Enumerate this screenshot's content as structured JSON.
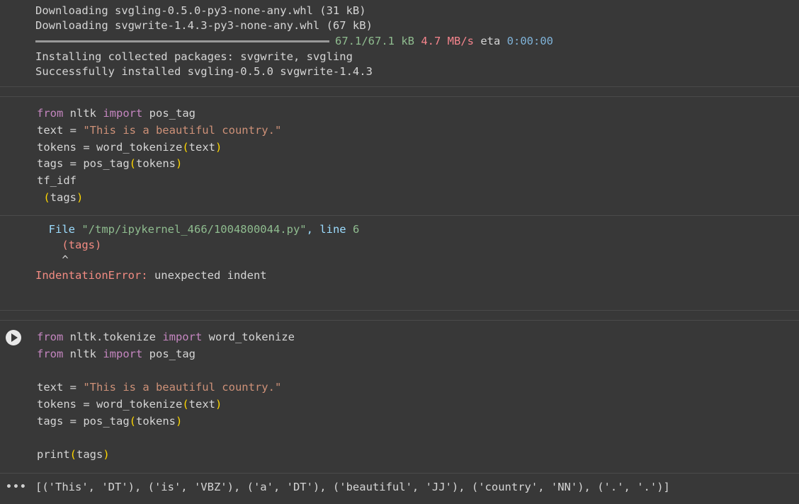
{
  "install_output": {
    "line1": "Downloading svgling-0.5.0-py3-none-any.whl (31 kB)",
    "line2": "Downloading svgwrite-1.4.3-py3-none-any.whl (67 kB)",
    "progress_size": "67.1/67.1 kB",
    "progress_speed": "4.7 MB/s",
    "progress_eta_label": "eta",
    "progress_eta": "0:00:00",
    "progress_fraction": 1.0,
    "line4": "Installing collected packages: svgwrite, svgling",
    "line5": "Successfully installed svgling-0.5.0 svgwrite-1.4.3"
  },
  "cell1": {
    "l1": {
      "kw1": "from",
      "mod": " nltk ",
      "kw2": "import",
      "rest": " pos_tag"
    },
    "l2": {
      "pre": "text = ",
      "str": "\"This is a beautiful country.\""
    },
    "l3": {
      "pre": "tokens = word_tokenize",
      "open": "(",
      "arg": "text",
      "close": ")"
    },
    "l4": {
      "pre": "tags = pos_tag",
      "open": "(",
      "arg": "tokens",
      "close": ")"
    },
    "l5": {
      "text": "tf_idf"
    },
    "l6": {
      "pre": " ",
      "open": "(",
      "arg": "tags",
      "close": ")"
    }
  },
  "error_output": {
    "file_label": "File ",
    "file_path": "\"/tmp/ipykernel_466/1004800044.py\"",
    "line_label": ", line ",
    "line_num": "6",
    "code": "(tags)",
    "caret": "^",
    "err_name": "IndentationError:",
    "err_msg": " unexpected indent"
  },
  "cell2": {
    "l1": {
      "kw1": "from",
      "mod": " nltk.tokenize ",
      "kw2": "import",
      "rest": " word_tokenize"
    },
    "l2": {
      "kw1": "from",
      "mod": " nltk ",
      "kw2": "import",
      "rest": " pos_tag"
    },
    "l3": {
      "pre": "text = ",
      "str": "\"This is a beautiful country.\""
    },
    "l4": {
      "pre": "tokens = word_tokenize",
      "open": "(",
      "arg": "text",
      "close": ")"
    },
    "l5": {
      "pre": "tags = pos_tag",
      "open": "(",
      "arg": "tokens",
      "close": ")"
    },
    "l6": {
      "pre": "print",
      "open": "(",
      "arg": "tags",
      "close": ")"
    }
  },
  "result_output": {
    "text": "[('This', 'DT'), ('is', 'VBZ'), ('a', 'DT'), ('beautiful', 'JJ'), ('country', 'NN'), ('.', '.')]"
  },
  "icons": {
    "run": "play-circle-icon",
    "more": "more-horizontal-icon"
  }
}
